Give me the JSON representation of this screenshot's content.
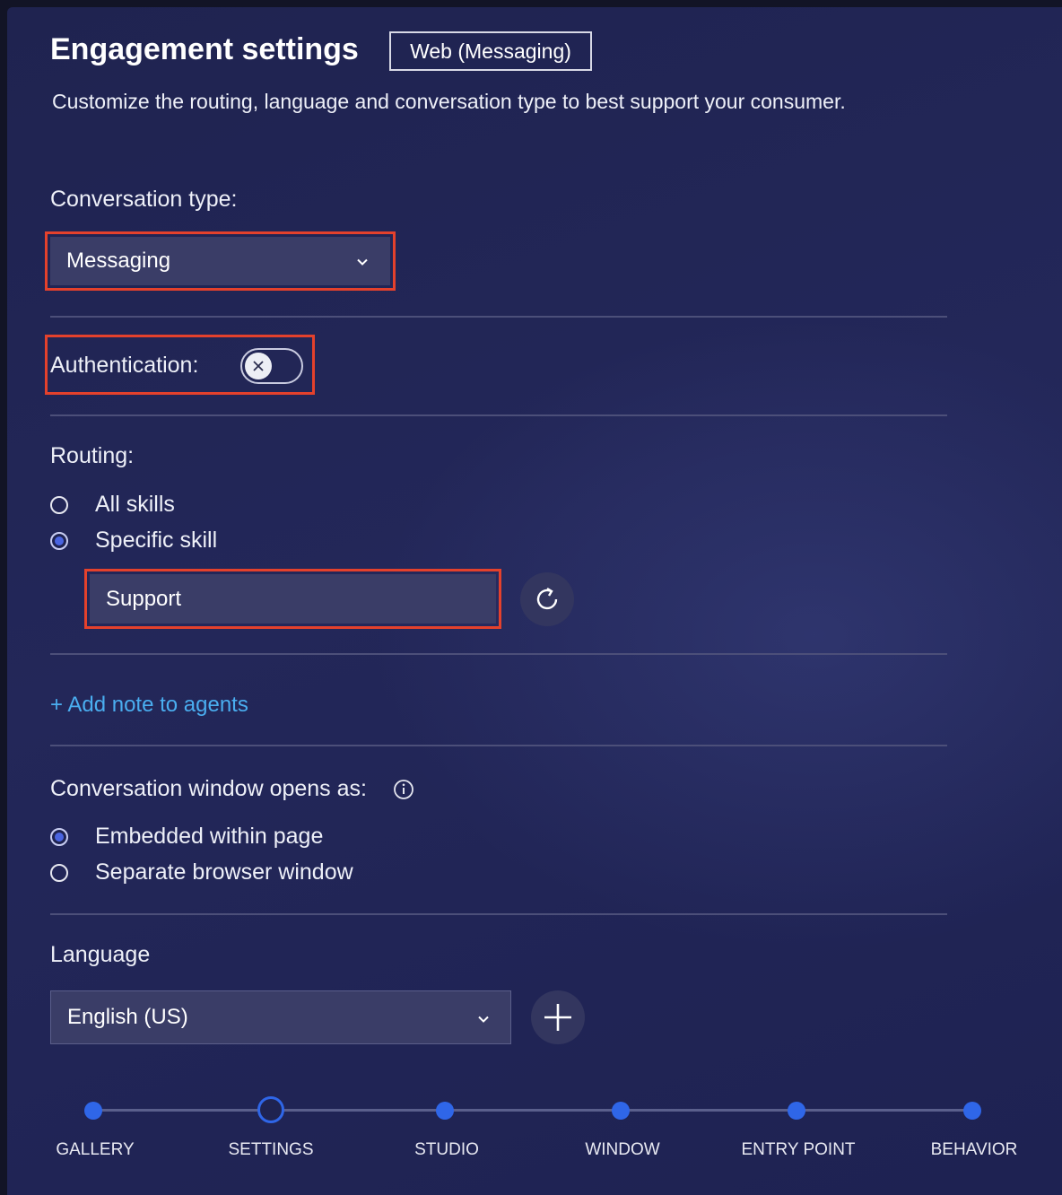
{
  "header": {
    "title": "Engagement settings",
    "channel": "Web (Messaging)",
    "subtitle": "Customize the routing, language and conversation type to best support your consumer."
  },
  "conversation_type": {
    "label": "Conversation type:",
    "selected": "Messaging"
  },
  "authentication": {
    "label": "Authentication:",
    "enabled": false
  },
  "routing": {
    "label": "Routing:",
    "options": [
      "All skills",
      "Specific skill"
    ],
    "selected": "Specific skill",
    "skill_value": "Support"
  },
  "notes": {
    "add_link": "+ Add note to agents"
  },
  "window_mode": {
    "label": "Conversation window opens as:",
    "options": [
      "Embedded within page",
      "Separate browser window"
    ],
    "selected": "Embedded within page"
  },
  "language": {
    "label": "Language",
    "selected": "English (US)"
  },
  "stepper": {
    "steps": [
      "GALLERY",
      "SETTINGS",
      "STUDIO",
      "WINDOW",
      "ENTRY POINT",
      "BEHAVIOR"
    ],
    "current": "SETTINGS"
  },
  "colors": {
    "highlight": "#e4412c",
    "accent": "#2f66e8",
    "link": "#4aaef0"
  }
}
